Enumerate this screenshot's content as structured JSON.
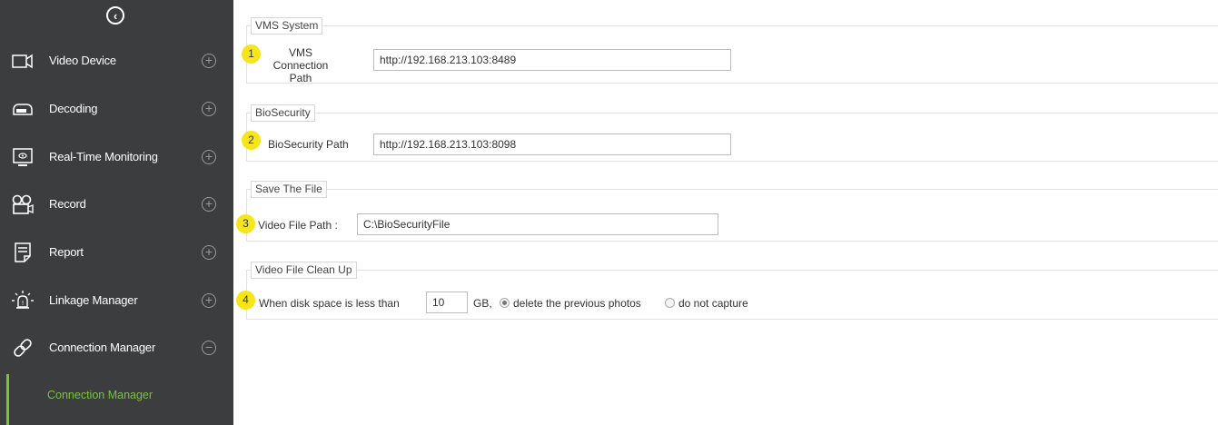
{
  "sidebar": {
    "collapse_icon": "chevron-left-circle-icon",
    "items": [
      {
        "label": "Video Device",
        "icon": "video-camera-icon",
        "toggle": "+"
      },
      {
        "label": "Decoding",
        "icon": "decoder-icon",
        "toggle": "+"
      },
      {
        "label": "Real-Time Monitoring",
        "icon": "monitor-icon",
        "toggle": "+"
      },
      {
        "label": "Record",
        "icon": "recorder-icon",
        "toggle": "+"
      },
      {
        "label": "Report",
        "icon": "report-icon",
        "toggle": "+"
      },
      {
        "label": "Linkage Manager",
        "icon": "alarm-icon",
        "toggle": "+"
      },
      {
        "label": "Connection Manager",
        "icon": "link-icon",
        "toggle": "−"
      }
    ],
    "subitem": {
      "label": "Connection Manager",
      "active_color": "#7cc142"
    }
  },
  "sections": {
    "vms": {
      "title": "VMS System",
      "badge": "1",
      "label_line1": "VMS Connection",
      "label_line2": "Path",
      "value": "http://192.168.213.103:8489"
    },
    "biosecurity": {
      "title": "BioSecurity",
      "badge": "2",
      "label": "BioSecurity Path",
      "value": "http://192.168.213.103:8098"
    },
    "save_file": {
      "title": "Save The File",
      "badge": "3",
      "label": "Video File Path :",
      "value": "C:\\BioSecurityFile"
    },
    "cleanup": {
      "title": "Video File Clean Up",
      "badge": "4",
      "label_prefix": "When disk space is less than",
      "value": "10",
      "unit": "GB,",
      "option_delete": "delete the previous photos",
      "option_no_capture": "do not capture",
      "selected": "delete the previous photos"
    }
  },
  "colors": {
    "sidebar_bg": "#3b3d3e",
    "accent_green": "#7cc142",
    "badge_yellow": "#f5e51a"
  }
}
